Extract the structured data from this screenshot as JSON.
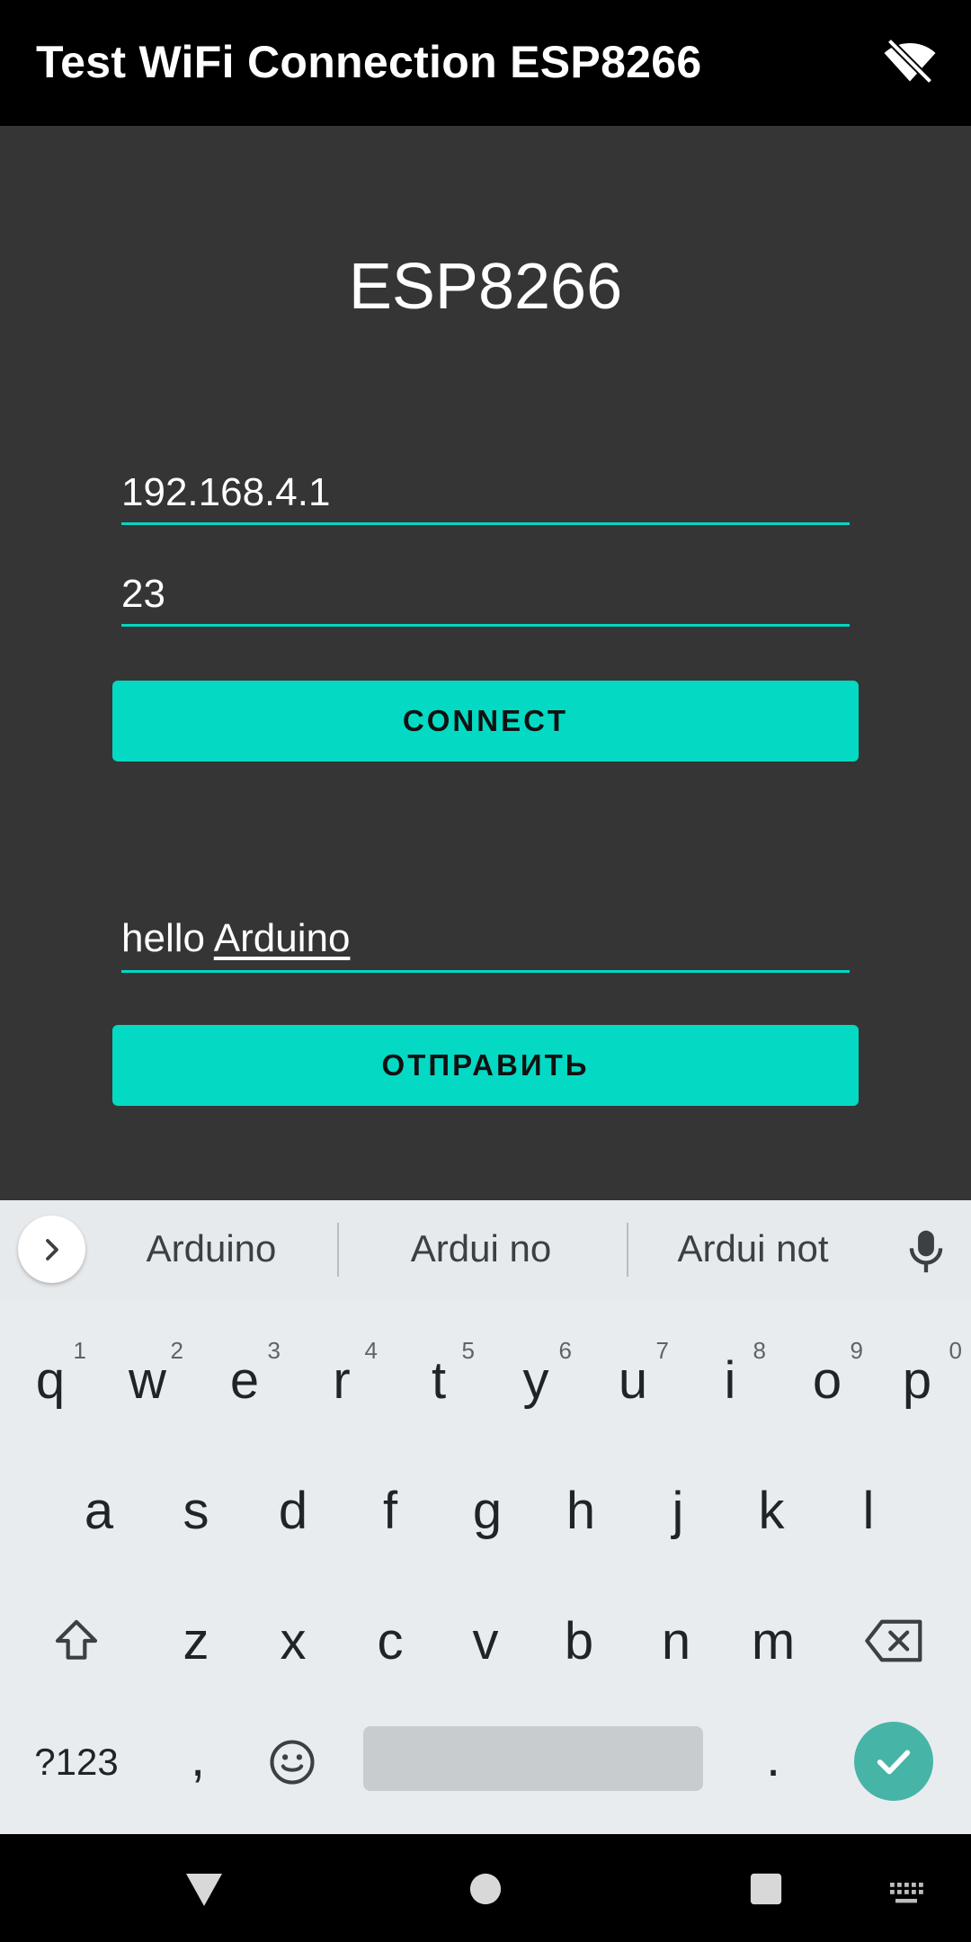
{
  "app_bar": {
    "title": "Test WiFi Connection ESP8266",
    "status_icon": "wifi-off-icon"
  },
  "main": {
    "heading": "ESP8266",
    "ip_field": {
      "value": "192.168.4.1"
    },
    "port_field": {
      "value": "23"
    },
    "connect_button": {
      "label": "CONNECT"
    },
    "message_field": {
      "text_before": "hello ",
      "composing_word": "Arduino"
    },
    "send_button": {
      "label": "ОТПРАВИТЬ"
    }
  },
  "keyboard": {
    "suggestions": [
      "Arduino",
      "Ardui no",
      "Ardui not"
    ],
    "row1": [
      {
        "key": "q",
        "hint": "1"
      },
      {
        "key": "w",
        "hint": "2"
      },
      {
        "key": "e",
        "hint": "3"
      },
      {
        "key": "r",
        "hint": "4"
      },
      {
        "key": "t",
        "hint": "5"
      },
      {
        "key": "y",
        "hint": "6"
      },
      {
        "key": "u",
        "hint": "7"
      },
      {
        "key": "i",
        "hint": "8"
      },
      {
        "key": "o",
        "hint": "9"
      },
      {
        "key": "p",
        "hint": "0"
      }
    ],
    "row2": [
      "a",
      "s",
      "d",
      "f",
      "g",
      "h",
      "j",
      "k",
      "l"
    ],
    "row3": [
      "z",
      "x",
      "c",
      "v",
      "b",
      "n",
      "m"
    ],
    "symbols_key": "?123",
    "comma_key": ",",
    "period_key": "."
  },
  "colors": {
    "accent": "#04d9c3",
    "content_background": "#353535",
    "keyboard_background": "#e9ecef",
    "enter_key": "#47b4a8"
  }
}
